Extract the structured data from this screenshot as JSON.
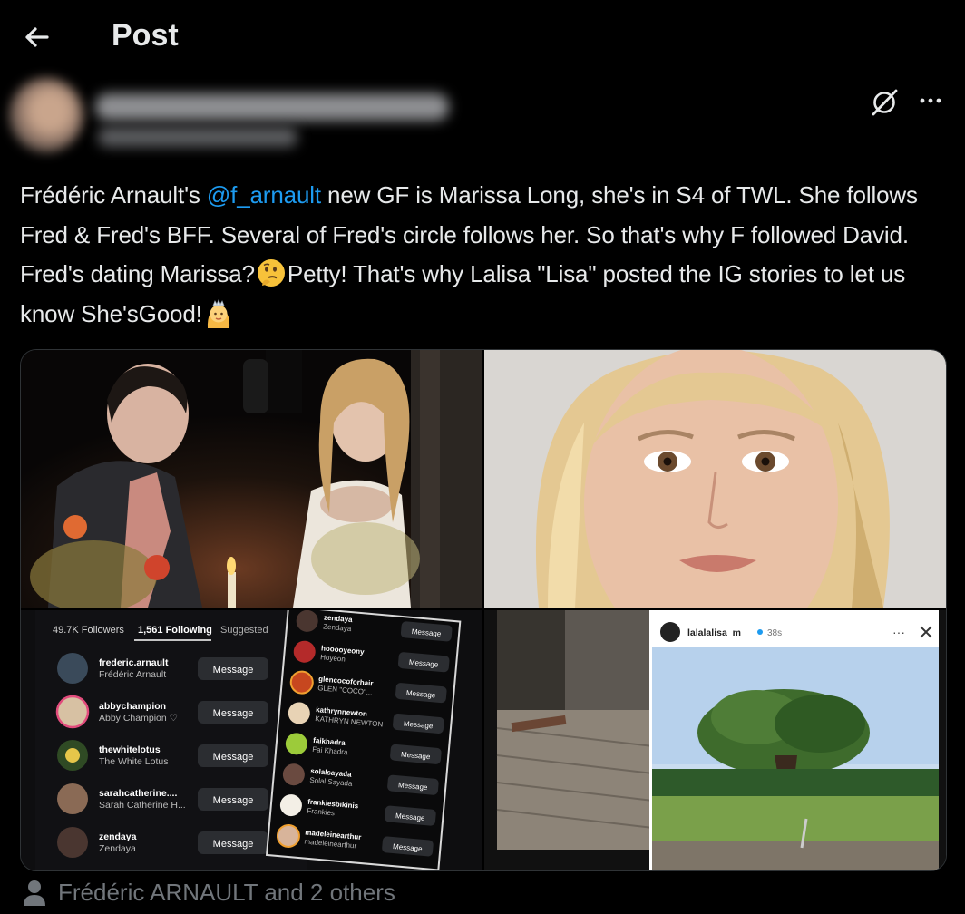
{
  "header": {
    "title": "Post"
  },
  "tweet": {
    "text_1": "Frédéric Arnault's ",
    "mention": "@f_arnault",
    "text_2": " new GF is Marissa Long, she's in S4 of TWL. She follows Fred & Fred's BFF. Several of Fred's circle follows her. So that's why F followed David. Fred's dating Marissa?",
    "text_3": "Petty! That's why Lalisa \"Lisa\" posted the IG stories to let us know She'sGood!"
  },
  "ig_list": {
    "tabs": {
      "followers": "49.7K Followers",
      "following": "1,561 Following",
      "suggested": "Suggested"
    },
    "rows": [
      {
        "user": "frederic.arnault",
        "name": "Frédéric Arnault",
        "btn": "Message"
      },
      {
        "user": "abbychampion",
        "name": "Abby Champion ♡",
        "btn": "Message"
      },
      {
        "user": "thewhitelotus",
        "name": "The White Lotus",
        "btn": "Message"
      },
      {
        "user": "sarahcatherine....",
        "name": "Sarah Catherine H...",
        "btn": "Message"
      },
      {
        "user": "zendaya",
        "name": "Zendaya",
        "btn": "Message"
      }
    ]
  },
  "ig_list2": {
    "rows": [
      {
        "user": "zendaya",
        "name": "Zendaya",
        "btn": "Message"
      },
      {
        "user": "hooooyeony",
        "name": "Hoyeon",
        "btn": "Message"
      },
      {
        "user": "glencocoforhair",
        "name": "GLEN \"COCO\"...",
        "btn": "Message"
      },
      {
        "user": "kathrynnewton",
        "name": "KATHRYN NEWTON",
        "btn": "Message"
      },
      {
        "user": "faikhadra",
        "name": "Fai Khadra",
        "btn": "Message"
      },
      {
        "user": "solalsayada",
        "name": "Solal Sayada",
        "btn": "Message"
      },
      {
        "user": "frankiesbikinis",
        "name": "Frankies",
        "btn": "Message"
      },
      {
        "user": "madeleinearthur",
        "name": "madeleinearthur",
        "btn": "Message"
      }
    ]
  },
  "story": {
    "user": "lalalalisa_m",
    "time": "38s"
  },
  "tagged": {
    "label": "Frédéric ARNAULT and 2 others"
  },
  "colors": {
    "accent": "#1d9bf0",
    "text": "#e7e9ea",
    "muted": "#71767b",
    "border": "#2f3336"
  },
  "icons": {
    "back": "arrow-left-icon",
    "grok": "grok-icon",
    "more": "more-icon",
    "person": "person-icon"
  }
}
